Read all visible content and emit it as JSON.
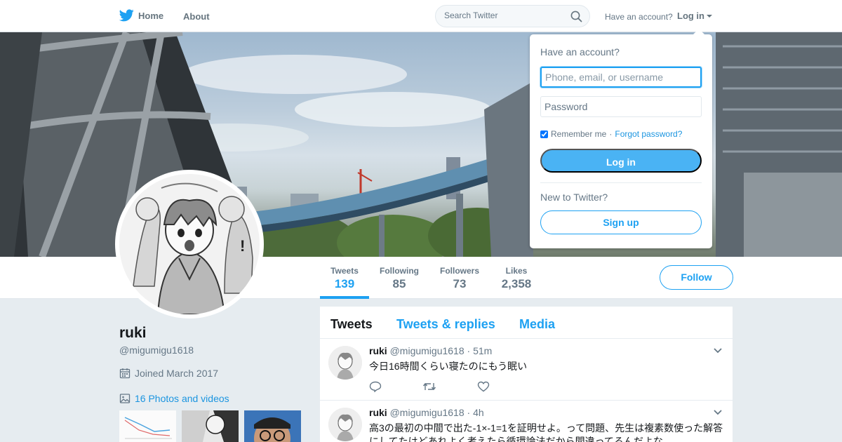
{
  "nav": {
    "home_label": "Home",
    "about_label": "About",
    "search_placeholder": "Search Twitter",
    "have_account": "Have an account?",
    "login_label": "Log in"
  },
  "profile": {
    "name": "ruki",
    "handle": "@migumigu1618",
    "joined": "Joined March 2017",
    "photos_label": "16 Photos and videos",
    "follow_label": "Follow"
  },
  "stats": [
    {
      "label": "Tweets",
      "value": "139"
    },
    {
      "label": "Following",
      "value": "85"
    },
    {
      "label": "Followers",
      "value": "73"
    },
    {
      "label": "Likes",
      "value": "2,358"
    }
  ],
  "timeline": {
    "tabs": [
      "Tweets",
      "Tweets & replies",
      "Media"
    ],
    "tweets": [
      {
        "name": "ruki",
        "handle": "@migumigu1618",
        "time": "· 51m",
        "text": "今日16時間くらい寝たのにもう眠い"
      },
      {
        "name": "ruki",
        "handle": "@migumigu1618",
        "time": "· 4h",
        "text": "高3の最初の中間で出た-1×-1=1を証明せよ。って問題、先生は複素数使った解答にしてたけどあれよく考えたら循環論法だから間違ってるんだよな"
      }
    ]
  },
  "login_dropdown": {
    "title": "Have an account?",
    "username_placeholder": "Phone, email, or username",
    "password_placeholder": "Password",
    "remember_label": "Remember me",
    "separator": "·",
    "forgot_label": "Forgot password?",
    "login_button": "Log in",
    "new_label": "New to Twitter?",
    "signup_button": "Sign up"
  },
  "colors": {
    "accent": "#1da1f2",
    "login_button": "#4ab3f4",
    "background": "#e6ecf0"
  },
  "icons": [
    "twitter-bird-icon",
    "search-icon",
    "calendar-icon",
    "image-icon",
    "reply-icon",
    "retweet-icon",
    "heart-icon",
    "chevron-down-icon"
  ]
}
